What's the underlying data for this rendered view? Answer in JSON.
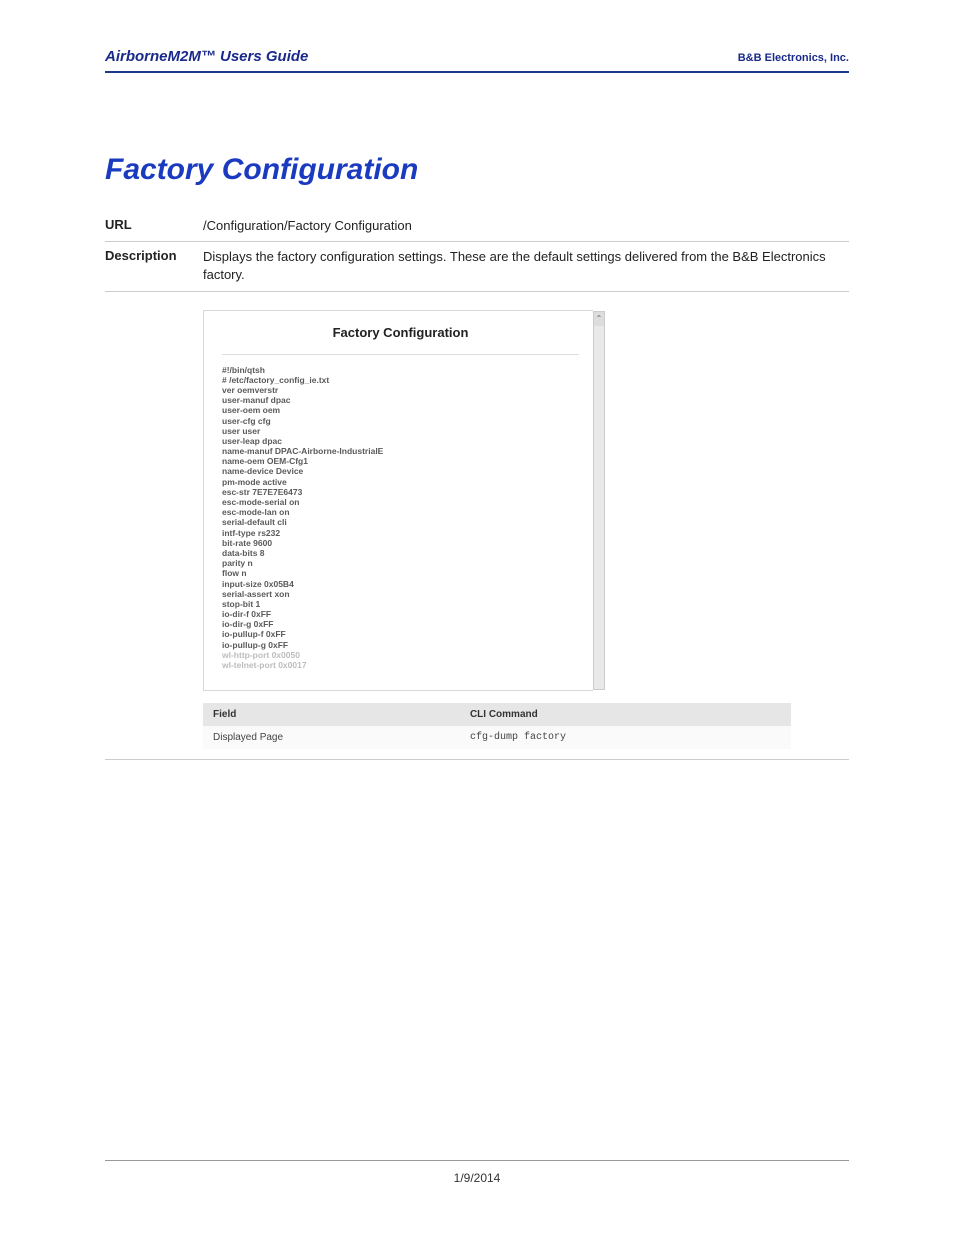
{
  "header": {
    "left": "AirborneM2M™ Users Guide",
    "right": "B&B Electronics, Inc."
  },
  "title": "Factory Configuration",
  "meta": {
    "url_label": "URL",
    "url_value": "/Configuration/Factory Configuration",
    "desc_label": "Description",
    "desc_value": "Displays the factory configuration settings. These are the default settings delivered from the B&B Electronics factory."
  },
  "screenshot": {
    "heading": "Factory Configuration",
    "lines": [
      "#!/bin/qtsh",
      "# /etc/factory_config_ie.txt",
      "ver oemverstr",
      "user-manuf dpac",
      "user-oem oem",
      "user-cfg cfg",
      "user user",
      "user-leap dpac",
      "name-manuf DPAC-Airborne-IndustrialE",
      "name-oem OEM-Cfg1",
      "name-device Device",
      "pm-mode active",
      "esc-str 7E7E7E6473",
      "esc-mode-serial on",
      "esc-mode-lan on",
      "serial-default cli",
      "intf-type rs232",
      "bit-rate 9600",
      "data-bits 8",
      "parity n",
      "flow n",
      "input-size 0x05B4",
      "serial-assert xon",
      "stop-bit 1",
      "io-dir-f 0xFF",
      "io-dir-g 0xFF",
      "io-pullup-f 0xFF",
      "io-pullup-g 0xFF"
    ],
    "faded_lines": [
      "wl-http-port 0x0050",
      "wl-telnet-port 0x0017"
    ]
  },
  "field_table": {
    "head_field": "Field",
    "head_cmd": "CLI Command",
    "row_field": "Displayed Page",
    "row_cmd": "cfg-dump factory"
  },
  "footer": {
    "date": "1/9/2014"
  }
}
